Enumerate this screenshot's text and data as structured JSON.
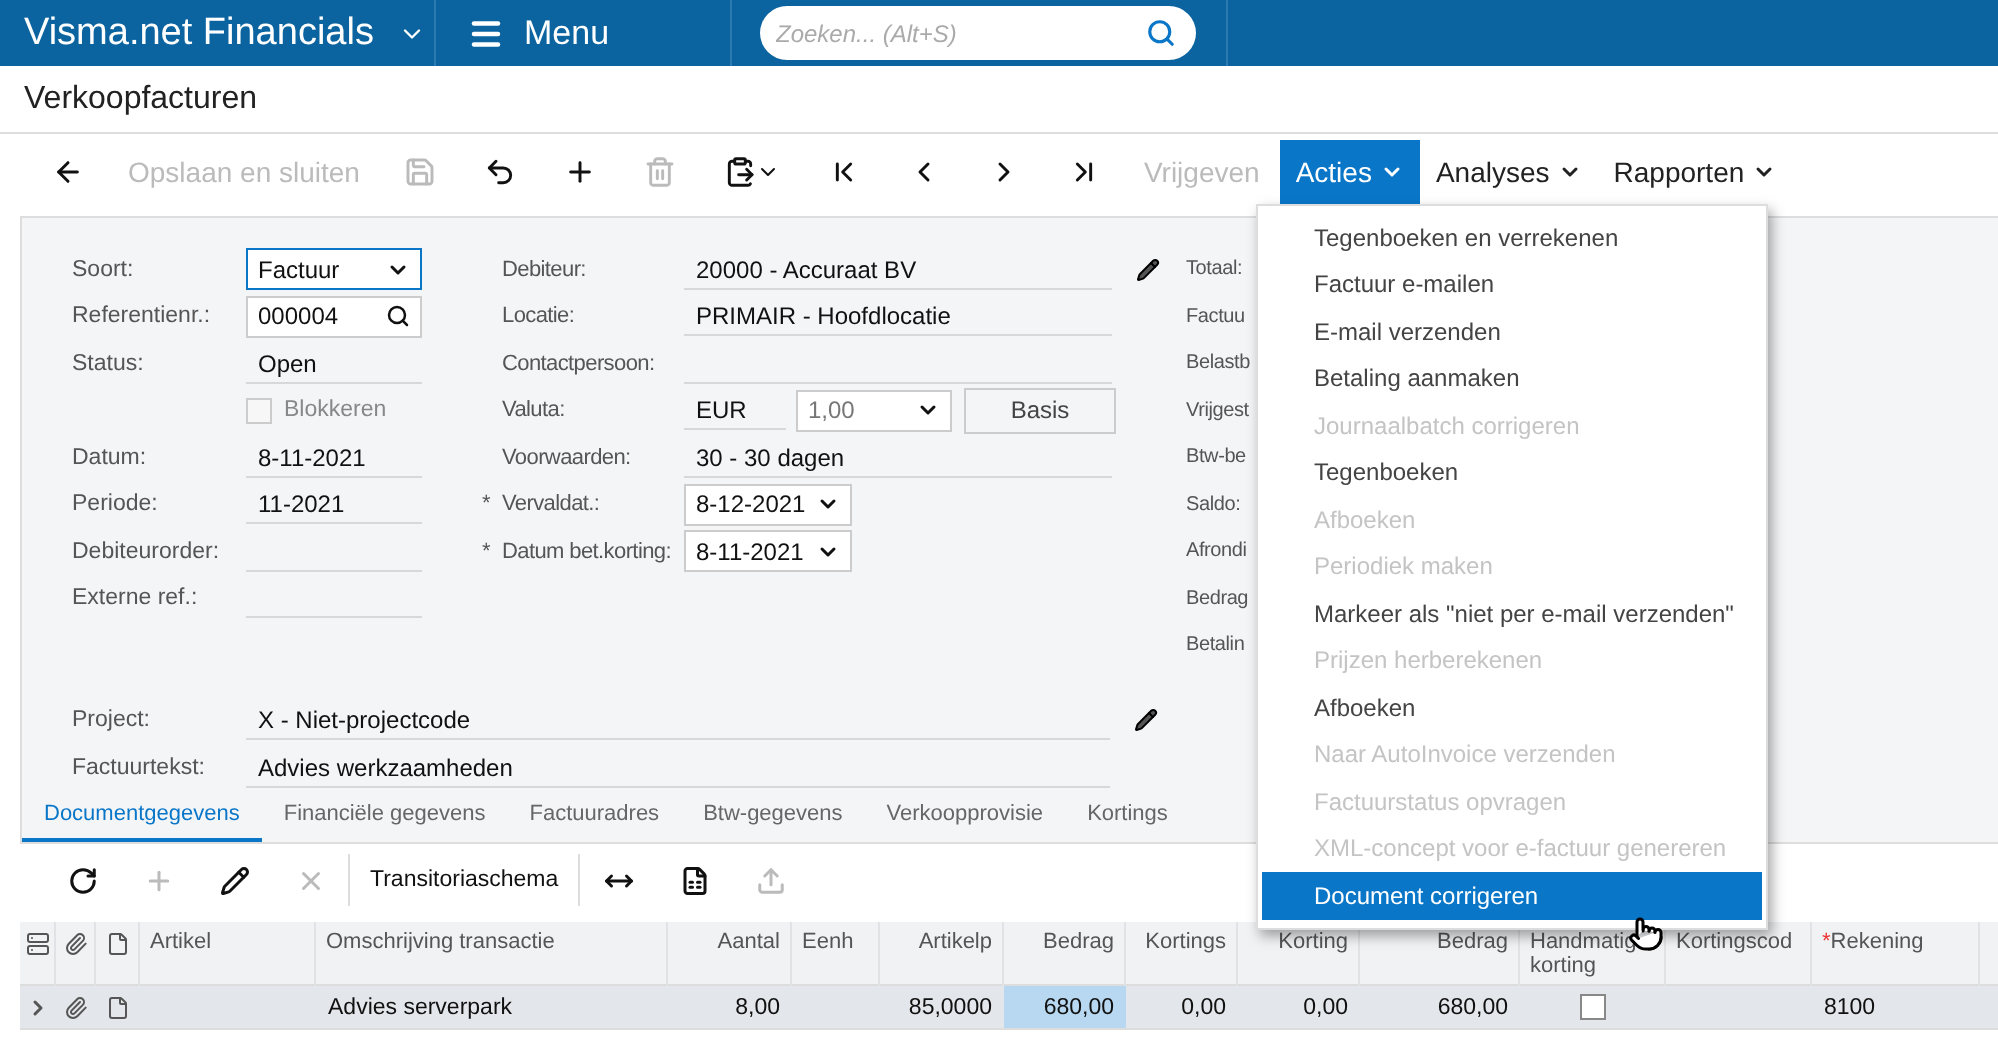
{
  "topbar": {
    "brand": "Visma.net Financials",
    "menu": "Menu",
    "search": {
      "placeholder": "Zoeken... (Alt+S)"
    }
  },
  "page_title": "Verkoopfacturen",
  "toolbar": [
    {
      "kind": "icon",
      "disabled": false
    },
    {
      "kind": "text",
      "label": "Opslaan en sluiten",
      "disabled": true
    },
    {
      "kind": "icon",
      "disabled": true
    },
    {
      "kind": "icon",
      "disabled": false
    },
    {
      "kind": "icon",
      "disabled": false
    },
    {
      "kind": "icon",
      "disabled": true
    },
    {
      "kind": "icon",
      "disabled": false
    },
    {
      "kind": "icon",
      "disabled": false
    },
    {
      "kind": "icon",
      "disabled": false
    },
    {
      "kind": "icon",
      "disabled": false
    },
    {
      "kind": "icon",
      "disabled": false
    },
    {
      "kind": "text",
      "label": "Vrijgeven",
      "disabled": true
    },
    {
      "kind": "menu",
      "label": "Acties",
      "selected": true
    },
    {
      "kind": "menu",
      "label": "Analyses",
      "selected": false
    },
    {
      "kind": "menu",
      "label": "Rapporten",
      "selected": false
    }
  ],
  "actions_menu": [
    {
      "label": "Tegenboeken en verrekenen",
      "disabled": false,
      "selected": false
    },
    {
      "label": "Factuur e-mailen",
      "disabled": false,
      "selected": false
    },
    {
      "label": "E-mail verzenden",
      "disabled": false,
      "selected": false
    },
    {
      "label": "Betaling aanmaken",
      "disabled": false,
      "selected": false
    },
    {
      "label": "Journaalbatch corrigeren",
      "disabled": true,
      "selected": false
    },
    {
      "label": "Tegenboeken",
      "disabled": false,
      "selected": false
    },
    {
      "label": "Afboeken",
      "disabled": true,
      "selected": false
    },
    {
      "label": "Periodiek maken",
      "disabled": true,
      "selected": false
    },
    {
      "label": "Markeer als \"niet per e-mail verzenden\"",
      "disabled": false,
      "selected": false
    },
    {
      "label": "Prijzen herberekenen",
      "disabled": true,
      "selected": false
    },
    {
      "label": "Afboeken",
      "disabled": false,
      "selected": false
    },
    {
      "label": "Naar AutoInvoice verzenden",
      "disabled": true,
      "selected": false
    },
    {
      "label": "Factuurstatus opvragen",
      "disabled": true,
      "selected": false
    },
    {
      "label": "XML-concept voor e-factuur genereren",
      "disabled": true,
      "selected": false
    },
    {
      "label": "Document corrigeren",
      "disabled": false,
      "selected": true
    }
  ],
  "form": {
    "left": [
      {
        "kind": "select",
        "label": "Soort:",
        "value": "Factuur"
      },
      {
        "kind": "lookup",
        "label": "Referentienr.:",
        "value": "000004"
      },
      {
        "kind": "text",
        "label": "Status:",
        "value": "Open"
      },
      {
        "kind": "checkbox",
        "label": "Blokkeren",
        "checked": false
      },
      {
        "kind": "text",
        "label": "Datum:",
        "value": "8-11-2021"
      },
      {
        "kind": "text",
        "label": "Periode:",
        "value": "11-2021"
      },
      {
        "kind": "text",
        "label": "Debiteurorder:"
      },
      {
        "kind": "text",
        "label": "Externe ref.:"
      }
    ],
    "middle": [
      {
        "kind": "text",
        "label": "Debiteur:",
        "value": "20000 - Accuraat BV",
        "editable": true
      },
      {
        "kind": "text",
        "label": "Locatie:",
        "value": "PRIMAIR - Hoofdlocatie",
        "editable": false
      },
      {
        "kind": "text",
        "label": "Contactpersoon:",
        "editable": false
      },
      {
        "kind": "currency",
        "label": "Valuta:",
        "value": "EUR",
        "rate": "1,00",
        "button": "Basis",
        "editable": false
      },
      {
        "kind": "text",
        "label": "Voorwaarden:",
        "value": "30 - 30 dagen",
        "editable": false
      },
      {
        "kind": "date",
        "marker": "*",
        "label": "Vervaldat.:",
        "value": "8-12-2021",
        "editable": false
      },
      {
        "kind": "date",
        "marker": "*",
        "label": "Datum bet.korting:",
        "value": "8-11-2021",
        "editable": false
      }
    ],
    "right": [
      "Totaal:",
      "Factuu",
      "Belastb",
      "Vrijgest",
      "Btw-be",
      "Saldo:",
      "Afrondi",
      "Bedrag",
      "Betalin"
    ],
    "bottom": [
      {
        "label": "Project:",
        "value": "X - Niet-projectcode",
        "editable": true
      },
      {
        "label": "Factuurtekst:",
        "value": "Advies werkzaamheden",
        "editable": false
      }
    ]
  },
  "tabs": [
    {
      "label": "Documentgegevens",
      "selected": true
    },
    {
      "label": "Financiële gegevens",
      "selected": false
    },
    {
      "label": "Factuuradres",
      "selected": false
    },
    {
      "label": "Btw-gegevens",
      "selected": false
    },
    {
      "label": "Verkoopprovisie",
      "selected": false
    },
    {
      "label": "Kortings",
      "selected": false
    }
  ],
  "grid_toolbar": [
    {
      "kind": "icon",
      "disabled": false
    },
    {
      "kind": "icon",
      "disabled": true
    },
    {
      "kind": "icon",
      "disabled": false
    },
    {
      "kind": "icon",
      "disabled": true
    },
    {
      "kind": "text",
      "label": "Transitoriaschema",
      "disabled": false
    },
    {
      "kind": "icon",
      "disabled": false
    },
    {
      "kind": "icon",
      "disabled": false
    },
    {
      "kind": "icon",
      "disabled": true
    }
  ],
  "table": {
    "columns": [
      {
        "label": "Artikel"
      },
      {
        "label": "Omschrijving transactie"
      },
      {
        "label": "Aantal"
      },
      {
        "label": "Eenh"
      },
      {
        "label": "Artikelp"
      },
      {
        "label": "Bedrag"
      },
      {
        "label": "Kortings"
      },
      {
        "label": "Korting"
      },
      {
        "label": "Bedrag"
      },
      {
        "label": "Handmatig korting"
      },
      {
        "label": "Kortingscod"
      },
      {
        "label": "Rekening",
        "marker": "*"
      }
    ],
    "rows": [
      {
        "current": true,
        "cells": [
          {
            "kind": "text",
            "text": "",
            "selected": false
          },
          {
            "kind": "text",
            "text": "Advies serverpark",
            "selected": false
          },
          {
            "kind": "text",
            "text": "8,00",
            "selected": false
          },
          {
            "kind": "text",
            "text": "",
            "selected": false
          },
          {
            "kind": "text",
            "text": "85,0000",
            "selected": false
          },
          {
            "kind": "text",
            "text": "680,00",
            "selected": true
          },
          {
            "kind": "text",
            "text": "0,00",
            "selected": false
          },
          {
            "kind": "text",
            "text": "0,00",
            "selected": false
          },
          {
            "kind": "text",
            "text": "680,00",
            "selected": false
          },
          {
            "kind": "checkbox",
            "checked": false,
            "selected": false
          },
          {
            "kind": "text",
            "text": "",
            "selected": false
          },
          {
            "kind": "text",
            "text": "8100",
            "selected": false
          }
        ]
      }
    ]
  }
}
